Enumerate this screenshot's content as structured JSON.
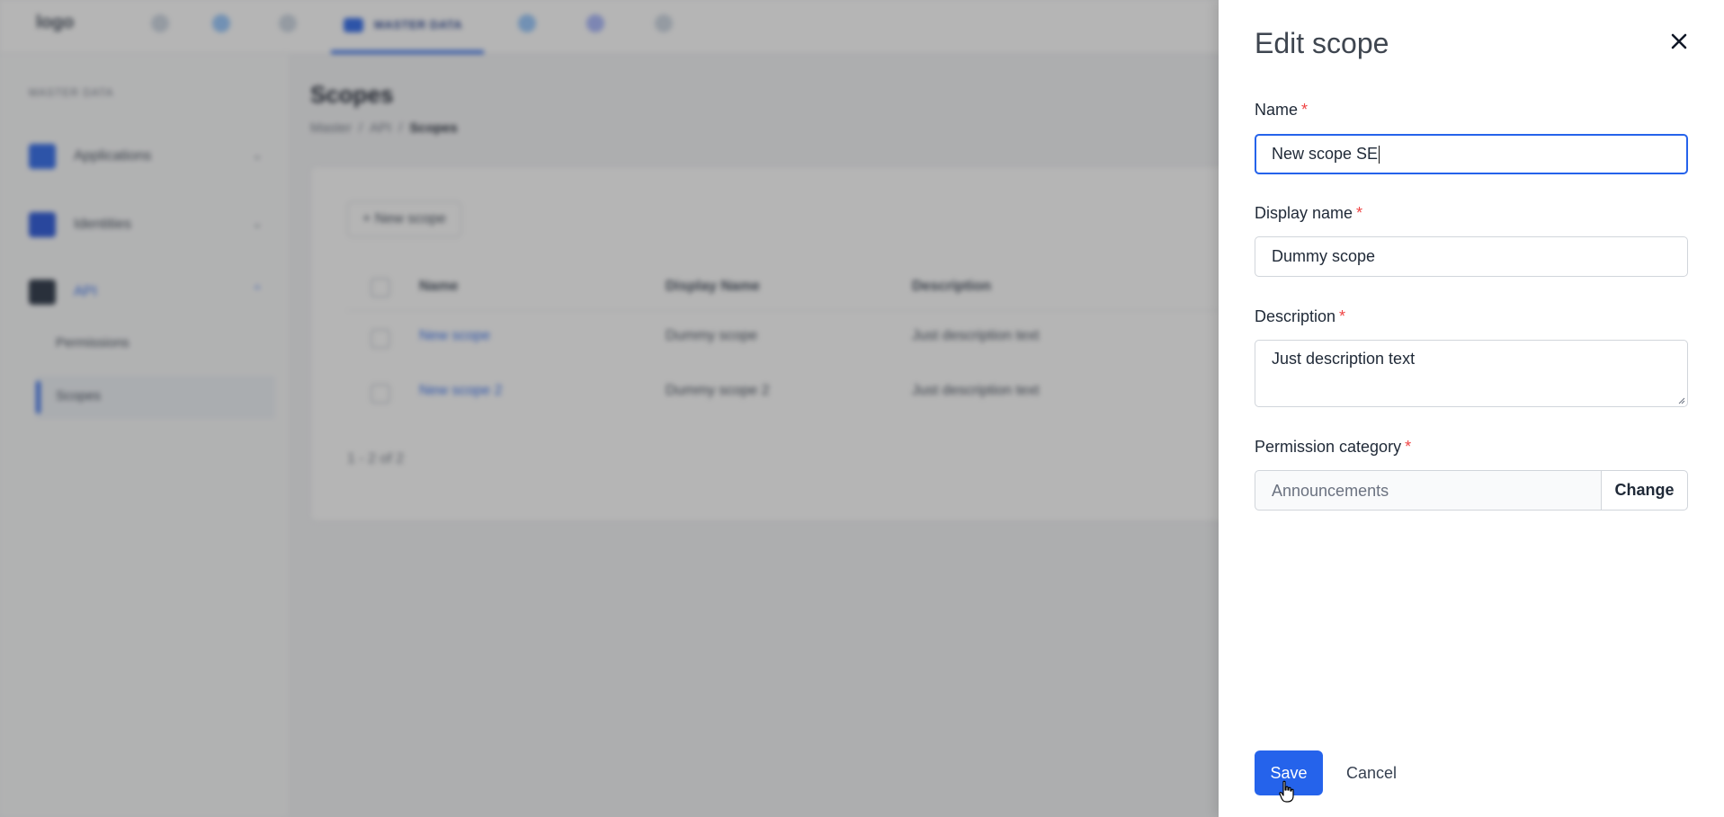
{
  "app": {
    "logo_alt": "logo",
    "active_tab": "MASTER DATA"
  },
  "sidebar": {
    "heading": "MASTER DATA",
    "items": [
      {
        "label": "Applications",
        "icon": "applications-icon"
      },
      {
        "label": "Identities",
        "icon": "shield-icon"
      },
      {
        "label": "API",
        "icon": "api-icon"
      }
    ],
    "sub_items": [
      "Permissions",
      "Scopes"
    ]
  },
  "main": {
    "title": "Scopes",
    "breadcrumb": [
      "Master",
      "API",
      "Scopes"
    ],
    "new_button": "+ New scope",
    "columns": [
      "Name",
      "Display Name",
      "Description"
    ],
    "rows": [
      {
        "name": "New scope",
        "display_name": "Dummy scope",
        "description": "Just description text"
      },
      {
        "name": "New scope 2",
        "display_name": "Dummy scope 2",
        "description": "Just description text"
      }
    ],
    "pager": "1 - 2 of 2"
  },
  "drawer": {
    "title": "Edit scope",
    "name_label": "Name",
    "name_value": "New scope SE",
    "display_name_label": "Display name",
    "display_name_value": "Dummy scope",
    "description_label": "Description",
    "description_value": "Just description text",
    "permission_label": "Permission category",
    "permission_value": "Announcements",
    "change_label": "Change",
    "save_label": "Save",
    "cancel_label": "Cancel",
    "required_mark": "*"
  },
  "colors": {
    "primary": "#2563eb",
    "required": "#ef4444",
    "overlay": "rgba(60,60,60,0.38)"
  }
}
